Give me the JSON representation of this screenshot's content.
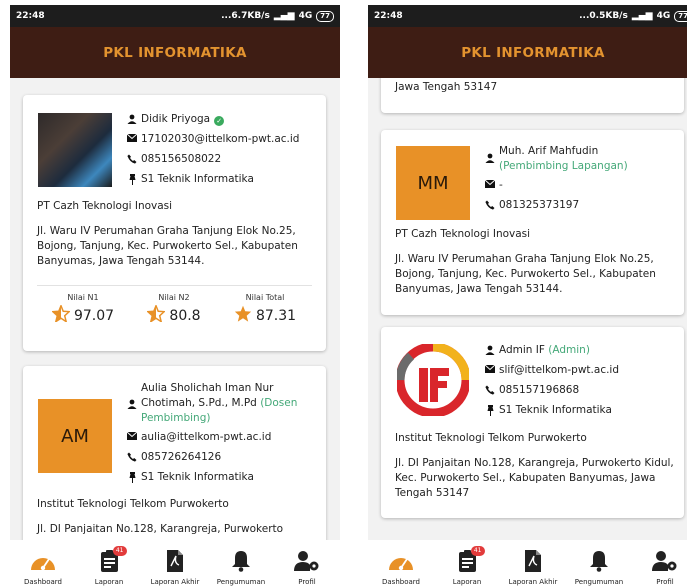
{
  "app_title": "PKL INFORMATIKA",
  "colors": {
    "header_bg": "#3e1d14",
    "title": "#e3932f",
    "role": "#44a878",
    "star": "#e89127"
  },
  "screens": [
    {
      "status": {
        "time": "22:48",
        "speed": "6.7KB/s",
        "network": "4G",
        "battery": "77"
      },
      "cards": [
        {
          "name": "Didik Priyoga",
          "email": "17102030@ittelkom-pwt.ac.id",
          "phone": "085156508022",
          "major": "S1 Teknik Informatika",
          "company": "PT Cazh Teknologi Inovasi",
          "address": "Jl. Waru IV Perumahan Graha Tanjung Elok No.25, Bojong, Tanjung, Kec. Purwokerto Sel., Kabupaten Banyumas, Jawa Tengah 53144.",
          "scores": [
            {
              "label": "Nilai N1",
              "value": "97.07"
            },
            {
              "label": "Nilai N2",
              "value": "80.8"
            },
            {
              "label": "Nilai Total",
              "value": "87.31"
            }
          ]
        },
        {
          "initials": "AM",
          "name": "Aulia Sholichah Iman Nur Chotimah, S.Pd., M.Pd",
          "role": "(Dosen Pembimbing)",
          "email": "aulia@ittelkom-pwt.ac.id",
          "phone": "085726264126",
          "major": "S1 Teknik Informatika",
          "org": "Institut Teknologi Telkom Purwokerto",
          "address": "Jl. DI Panjaitan No.128, Karangreja, Purwokerto"
        }
      ]
    },
    {
      "status": {
        "time": "22:48",
        "speed": "0.5KB/s",
        "network": "4G",
        "battery": "77"
      },
      "cards": [
        {
          "address_tail": "Jawa Tengah 53147"
        },
        {
          "initials": "MM",
          "name": "Muh. Arif Mahfudin",
          "role": "(Pembimbing Lapangan)",
          "email": "-",
          "phone": "081325373197",
          "company": "PT Cazh Teknologi Inovasi",
          "address": "Jl. Waru IV Perumahan Graha Tanjung Elok No.25, Bojong, Tanjung, Kec. Purwokerto Sel., Kabupaten Banyumas, Jawa Tengah 53144."
        },
        {
          "name": "Admin IF",
          "role": "(Admin)",
          "email": "slif@ittelkom-pwt.ac.id",
          "phone": "085157196868",
          "major": "S1 Teknik Informatika",
          "org": "Institut Teknologi Telkom Purwokerto",
          "address": "Jl. DI Panjaitan No.128, Karangreja, Purwokerto Kidul, Kec. Purwokerto Sel., Kabupaten Banyumas, Jawa Tengah 53147"
        }
      ]
    }
  ],
  "nav": [
    {
      "label": "Dashboard",
      "icon": "dashboard-gauge-icon"
    },
    {
      "label": "Laporan",
      "icon": "report-icon",
      "badge": "41"
    },
    {
      "label": "Laporan Akhir",
      "icon": "pdf-file-icon"
    },
    {
      "label": "Pengumuman",
      "icon": "bell-icon"
    },
    {
      "label": "Profil",
      "icon": "user-settings-icon"
    }
  ]
}
